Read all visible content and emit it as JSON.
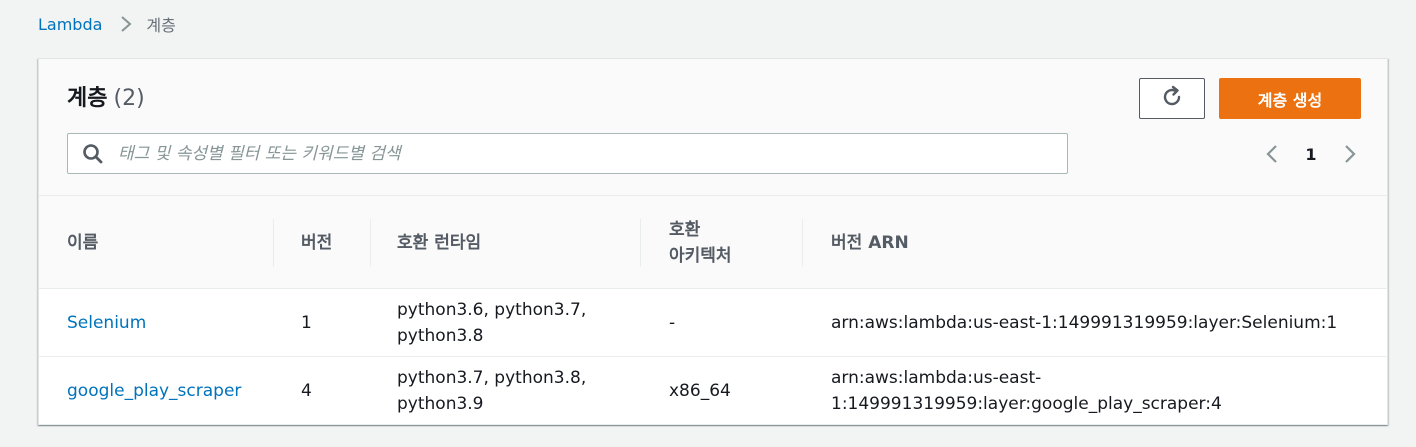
{
  "breadcrumb": {
    "root": "Lambda",
    "current": "계층"
  },
  "panel": {
    "title": "계층",
    "count": "(2)",
    "create_label": "계층 생성"
  },
  "search": {
    "placeholder": "태그 및 속성별 필터 또는 키워드별 검색",
    "value": ""
  },
  "pagination": {
    "current_page": "1"
  },
  "table": {
    "headers": {
      "name": "이름",
      "version": "버전",
      "runtime": "호환 런타임",
      "arch_line1": "호환",
      "arch_line2": "아키텍처",
      "arn": "버전 ARN"
    },
    "rows": [
      {
        "name": "Selenium",
        "version": "1",
        "runtime_line1": "python3.6, python3.7,",
        "runtime_line2": "python3.8",
        "arch": "-",
        "arn_line1": "arn:aws:lambda:us-east-1:149991319959:layer:Selenium:1",
        "arn_line2": ""
      },
      {
        "name": "google_play_scraper",
        "version": "4",
        "runtime_line1": "python3.7, python3.8,",
        "runtime_line2": "python3.9",
        "arch": "x86_64",
        "arn_line1": "arn:aws:lambda:us-east-",
        "arn_line2": "1:149991319959:layer:google_play_scraper:4"
      }
    ]
  },
  "icons": {
    "breadcrumb_separator": "chevron-right-icon",
    "refresh": "refresh-icon",
    "search": "search-icon",
    "prev_page": "chevron-left-icon",
    "next_page": "chevron-right-icon"
  },
  "colors": {
    "accent": "#ec7211",
    "link": "#0073bb",
    "background": "#f2f3f3"
  }
}
